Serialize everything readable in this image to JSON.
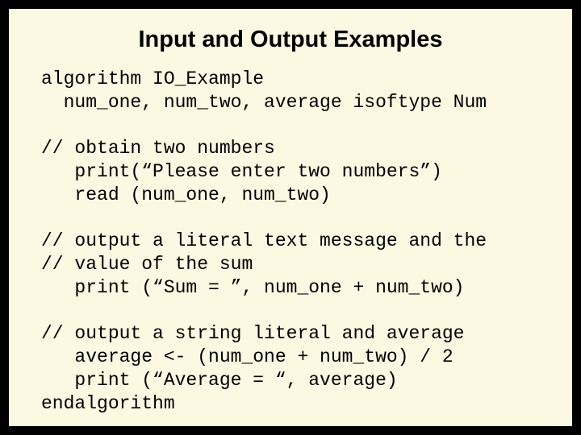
{
  "title": "Input and Output Examples",
  "code": {
    "l01": "algorithm IO_Example",
    "l02": "  num_one, num_two, average isoftype Num",
    "l03": "",
    "l04": "// obtain two numbers",
    "l05": "   print(“Please enter two numbers”)",
    "l06": "   read (num_one, num_two)",
    "l07": "",
    "l08": "// output a literal text message and the",
    "l09": "// value of the sum",
    "l10": "   print (“Sum = ”, num_one + num_two)",
    "l11": "",
    "l12": "// output a string literal and average",
    "l13": "   average <- (num_one + num_two) / 2",
    "l14": "   print (“Average = “, average)",
    "l15": "endalgorithm"
  }
}
